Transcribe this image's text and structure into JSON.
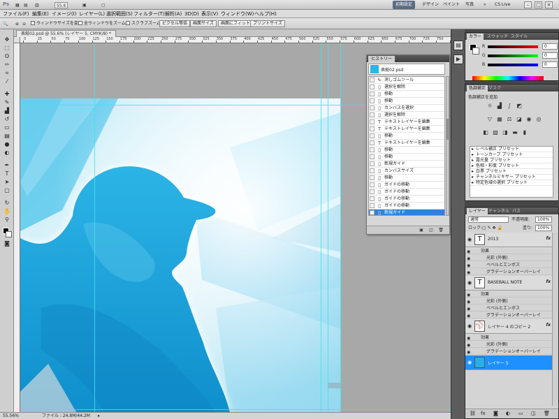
{
  "appbar": {
    "logo": "Ps",
    "zoom_value": "55.6",
    "workspaces": [
      "初期設定",
      "デザイン",
      "ペイント",
      "写真"
    ],
    "cs_live": "CS Live",
    "window_controls": [
      "–",
      "□",
      "×"
    ]
  },
  "menubar": {
    "items": [
      "ファイル(F)",
      "編集(E)",
      "イメージ(I)",
      "レイヤー(L)",
      "選択範囲(S)",
      "フィルター(T)",
      "解析(A)",
      "3D(D)",
      "表示(V)",
      "ウィンドウ(W)",
      "ヘルプ(H)"
    ]
  },
  "options": {
    "check_resize": "ウィンドウサイズを変更",
    "check_all_windows": "全ウィンドウをズーム",
    "check_scrubby": "スクラブズーム",
    "btn_actual_pixels": "ピクセル等倍",
    "btn_fit_screen": "画面サイズ",
    "btn_fill_screen": "画面にフィット",
    "btn_print_size": "プリントサイズ"
  },
  "document": {
    "tab_title": "表紙02.psd @ 55.6% (レイヤー 5, CMYK/8) *",
    "ruler_labels": [
      "0",
      "25",
      "50",
      "75",
      "100",
      "125",
      "150",
      "175",
      "200",
      "225",
      "250",
      "275",
      "300",
      "325",
      "350",
      "375",
      "400",
      "425",
      "450",
      "475",
      "500",
      "525",
      "550",
      "575",
      "600",
      "625",
      "650",
      "675",
      "700",
      "725",
      "750",
      "775"
    ]
  },
  "status": {
    "zoom": "55.56%",
    "file_info": "ファイル : 24.8M/44.2M"
  },
  "history": {
    "tab": "ヒストリー",
    "snapshot_label": "表紙02.psd",
    "items": [
      {
        "icon": "eraser-icon",
        "glyph": "✎",
        "label": "消しゴムツール"
      },
      {
        "icon": "doc-icon",
        "glyph": "▯",
        "label": "選択を解除"
      },
      {
        "icon": "move-icon",
        "glyph": "▯",
        "label": "移動"
      },
      {
        "icon": "move-icon",
        "glyph": "▯",
        "label": "移動"
      },
      {
        "icon": "doc-icon",
        "glyph": "▯",
        "label": "カンバスを選択"
      },
      {
        "icon": "doc-icon",
        "glyph": "▯",
        "label": "選択を解除"
      },
      {
        "icon": "text-icon",
        "glyph": "T",
        "label": "テキストレイヤーを編集"
      },
      {
        "icon": "text-icon",
        "glyph": "T",
        "label": "テキストレイヤーを編集"
      },
      {
        "icon": "move-icon",
        "glyph": "▯",
        "label": "移動"
      },
      {
        "icon": "text-icon",
        "glyph": "T",
        "label": "テキストレイヤーを編集"
      },
      {
        "icon": "move-icon",
        "glyph": "▯",
        "label": "移動"
      },
      {
        "icon": "move-icon",
        "glyph": "▯",
        "label": "移動"
      },
      {
        "icon": "doc-icon",
        "glyph": "▯",
        "label": "新規ガイド"
      },
      {
        "icon": "doc-icon",
        "glyph": "▯",
        "label": "カンバスサイズ"
      },
      {
        "icon": "move-icon",
        "glyph": "▯",
        "label": "移動"
      },
      {
        "icon": "doc-icon",
        "glyph": "▯",
        "label": "ガイドの移動"
      },
      {
        "icon": "doc-icon",
        "glyph": "▯",
        "label": "ガイドの移動"
      },
      {
        "icon": "doc-icon",
        "glyph": "▯",
        "label": "ガイドの移動"
      },
      {
        "icon": "doc-icon",
        "glyph": "▯",
        "label": "ガイドの移動"
      },
      {
        "icon": "doc-icon",
        "glyph": "▯",
        "label": "新規ガイド",
        "selected": true
      }
    ]
  },
  "color_panel": {
    "tabs": [
      "カラー",
      "スウォッチ",
      "スタイル"
    ],
    "sliders": [
      {
        "label": "R",
        "value": "0"
      },
      {
        "label": "G",
        "value": "0"
      },
      {
        "label": "B",
        "value": "0"
      }
    ]
  },
  "adjust_panel": {
    "tabs": [
      "色調補正",
      "マスク"
    ],
    "title": "色調補正を追加",
    "presets": [
      "レベル補正 プリセット",
      "トーンカーブ プリセット",
      "露光量 プリセット",
      "色相・彩度 プリセット",
      "白黒 プリセット",
      "チャンネルミキサー プリセット",
      "特定色域の選択 プリセット"
    ]
  },
  "layers_panel": {
    "tabs": [
      "レイヤー",
      "チャンネル",
      "パス"
    ],
    "blend_mode": "通常",
    "opacity_label": "不透明度:",
    "opacity_value": "100%",
    "lock_label": "ロック:",
    "fill_label": "塗り:",
    "fill_value": "100%",
    "effects_label": "効果",
    "layers": [
      {
        "name": "2013",
        "thumb": "T",
        "effects": [
          "光彩 (外側)",
          "ベベルとエンボス",
          "グラデーションオーバーレイ"
        ]
      },
      {
        "name": "BASEBALL NOTE",
        "thumb": "T",
        "effects": [
          "光彩 (外側)",
          "ベベルとエンボス",
          "グラデーションオーバーレイ"
        ]
      },
      {
        "name": "レイヤー 4 のコピー 2",
        "thumb": "⚾",
        "effects": [
          "光彩 (外側)",
          "グラデーションオーバーレイ"
        ]
      },
      {
        "name": "レイヤー 5",
        "thumb": "",
        "selected": true
      }
    ]
  },
  "colors": {
    "accent": "#2f82d6",
    "guide": "#45e0ea",
    "art_cyan": "#1aa3d9"
  }
}
